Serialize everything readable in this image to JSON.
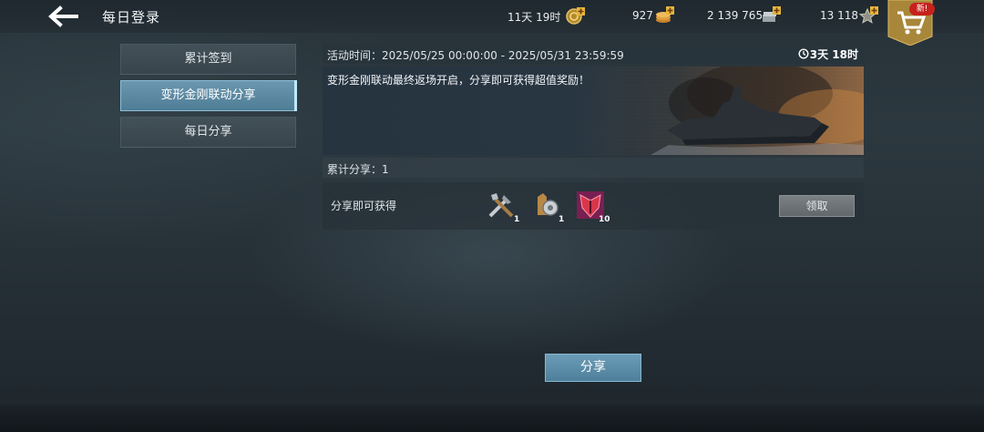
{
  "header": {
    "title": "每日登录",
    "resources": [
      {
        "value": "11天 19时",
        "icon": "gold-medal-icon"
      },
      {
        "value": "927",
        "icon": "coin-stack-icon"
      },
      {
        "value": "2 139 765",
        "icon": "silver-stack-icon"
      },
      {
        "value": "13 118",
        "icon": "star-icon"
      }
    ],
    "shop_badge": "新!"
  },
  "sidebar": {
    "tabs": [
      {
        "label": "累计签到",
        "active": false
      },
      {
        "label": "变形金刚联动分享",
        "active": true
      },
      {
        "label": "每日分享",
        "active": false
      }
    ]
  },
  "event": {
    "time_label": "活动时间：",
    "start": "2025/05/25  00:00:00",
    "separator": "-",
    "end": "2025/05/31  23:59:59",
    "countdown": "3天 18时",
    "banner_text": "变形金刚联动最终返场开启，分享即可获得超值奖励！",
    "share_count_label": "累计分享：",
    "share_count": "1"
  },
  "reward": {
    "label": "分享即可获得",
    "items": [
      {
        "icon": "repair-tools-icon",
        "qty": "1"
      },
      {
        "icon": "shell-part-icon",
        "qty": "1"
      },
      {
        "icon": "decepticon-emblem-icon",
        "qty": "10"
      }
    ],
    "claim_label": "领取"
  },
  "share_button_label": "分享",
  "colors": {
    "accent": "#5a8ba6",
    "badge": "#c7211c",
    "shop_gold": "#b8923c"
  }
}
